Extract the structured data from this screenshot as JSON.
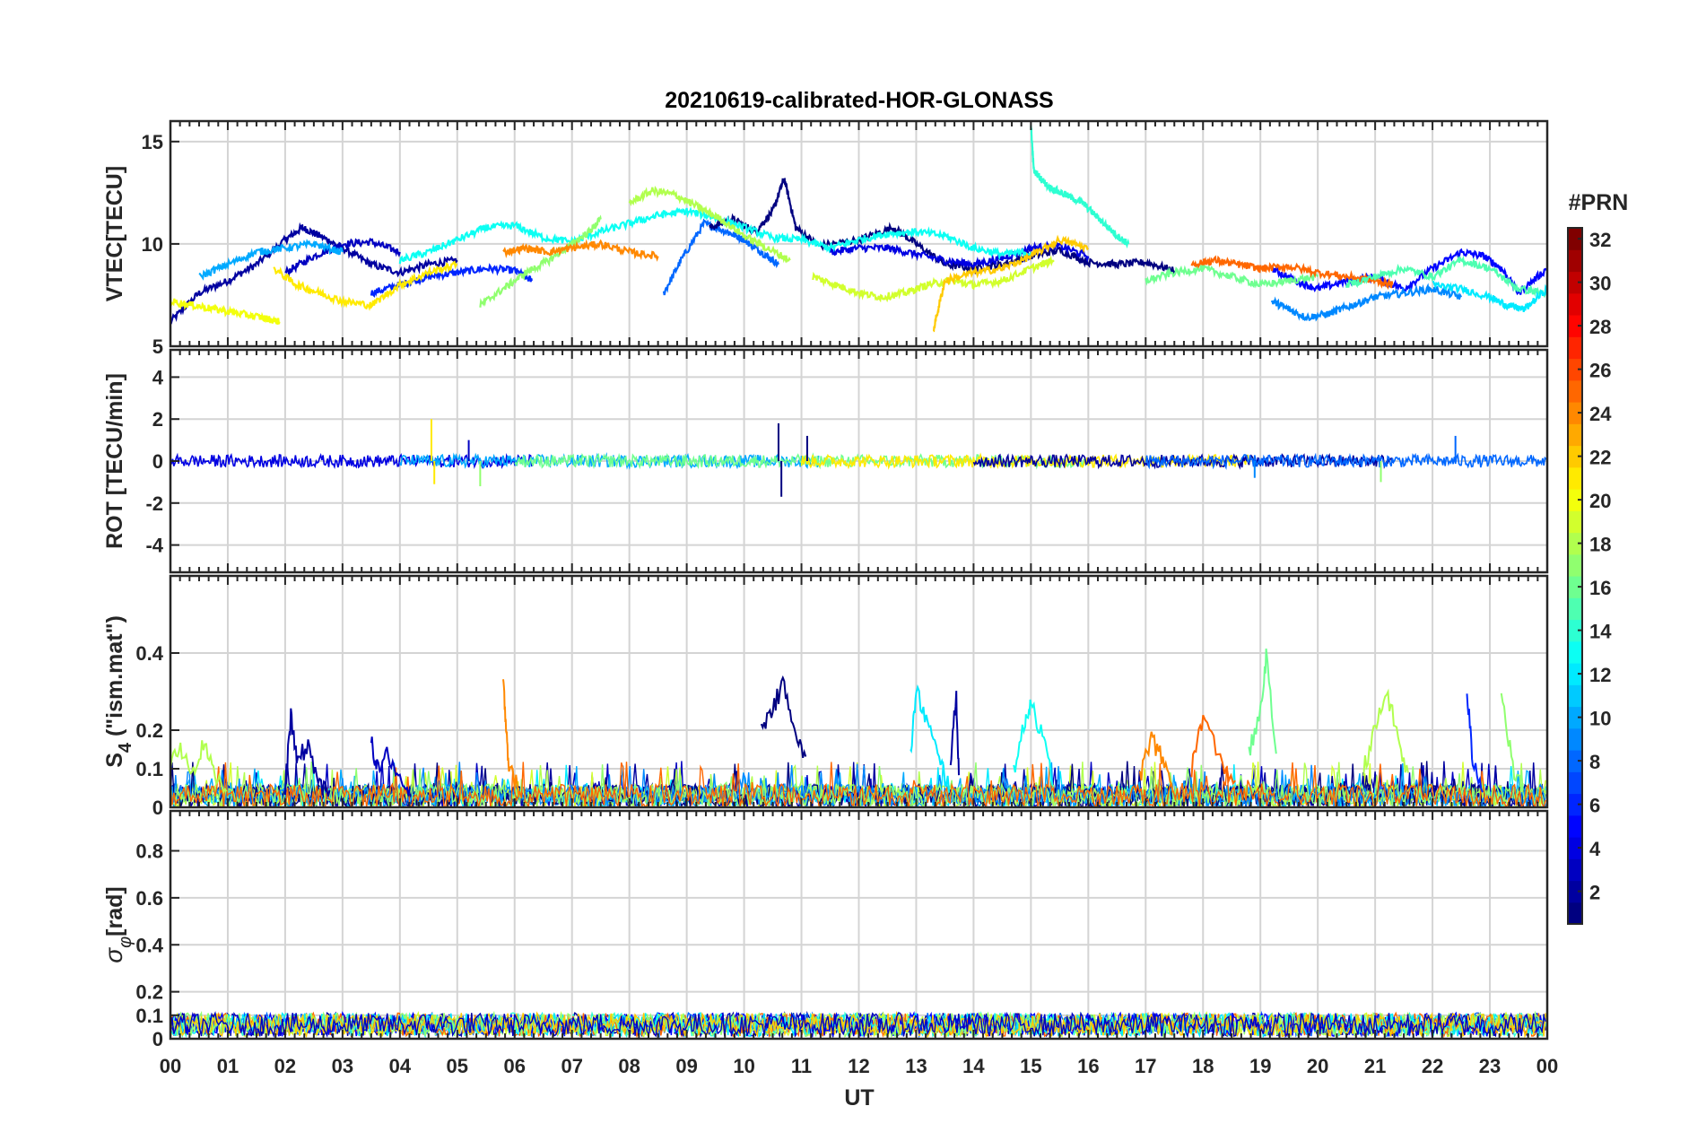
{
  "chart_data": {
    "type": "line",
    "title": "20210619-calibrated-HOR-GLONASS",
    "xlabel": "UT",
    "x_ticks": [
      "00",
      "01",
      "02",
      "03",
      "04",
      "05",
      "06",
      "07",
      "08",
      "09",
      "10",
      "11",
      "12",
      "13",
      "14",
      "15",
      "16",
      "17",
      "18",
      "19",
      "20",
      "21",
      "22",
      "23",
      "00"
    ],
    "xlim": [
      0,
      24
    ],
    "grid": true,
    "colorbar": {
      "label": "#PRN",
      "range": [
        1,
        32
      ],
      "ticks": [
        "2",
        "4",
        "6",
        "8",
        "10",
        "12",
        "14",
        "16",
        "18",
        "20",
        "22",
        "24",
        "26",
        "28",
        "30",
        "32"
      ],
      "colormap": "jet"
    },
    "panels": [
      {
        "id": "vtec",
        "ylabel_main": "VTEC[TECU]",
        "ylim": [
          5,
          16
        ],
        "yticks": [
          5,
          10,
          15
        ],
        "ytick_labels": [
          "5",
          "10",
          "15"
        ],
        "series": [
          {
            "prn": 2,
            "x": [
              0,
              0.5,
              1,
              1.5,
              2,
              2.3,
              2.6,
              3,
              3.5,
              4,
              4.5,
              5
            ],
            "y": [
              6.2,
              7.6,
              8.2,
              9.0,
              10.2,
              10.8,
              10.4,
              9.8,
              9.0,
              8.6,
              9.0,
              9.2
            ]
          },
          {
            "prn": 3,
            "x": [
              2,
              2.5,
              3,
              3.5,
              4
            ],
            "y": [
              8.6,
              9.4,
              10.0,
              10.1,
              9.6
            ]
          },
          {
            "prn": 6,
            "x": [
              3.5,
              4,
              4.5,
              5,
              5.5,
              6,
              6.3
            ],
            "y": [
              7.6,
              8.0,
              8.4,
              8.6,
              8.8,
              8.7,
              8.2
            ]
          },
          {
            "prn": 8,
            "x": [
              8.6,
              8.9,
              9.3,
              9.7,
              10,
              10.3,
              10.6
            ],
            "y": [
              7.6,
              9.2,
              11.0,
              10.6,
              10.2,
              9.6,
              9.0
            ]
          },
          {
            "prn": 1,
            "x": [
              9.4,
              9.8,
              10.2,
              10.5,
              10.7,
              10.9,
              11.3,
              12,
              12.6,
              13,
              13.5,
              14,
              14.5,
              15,
              15.5,
              16,
              16.5,
              17,
              17.5
            ],
            "y": [
              10.8,
              11.2,
              10.6,
              11.6,
              13.2,
              10.8,
              9.9,
              10.2,
              10.8,
              10.0,
              9.0,
              8.8,
              9.0,
              9.4,
              9.7,
              9.1,
              9.0,
              9.1,
              8.7
            ]
          },
          {
            "prn": 4,
            "x": [
              11.5,
              12,
              12.5,
              13,
              13.5,
              14,
              14.5,
              15,
              15.5,
              16
            ],
            "y": [
              9.6,
              9.8,
              9.8,
              9.5,
              9.2,
              9.0,
              9.3,
              9.8,
              9.9,
              9.4
            ]
          },
          {
            "prn": 5,
            "x": [
              19.2,
              19.6,
              20,
              20.5,
              21,
              21.5,
              22,
              22.5,
              22.9,
              23.2,
              23.5,
              24
            ],
            "y": [
              8.8,
              8.2,
              7.8,
              8.2,
              8.4,
              7.8,
              8.8,
              9.6,
              9.4,
              8.8,
              7.6,
              8.8
            ]
          },
          {
            "prn": 9,
            "x": [
              19.2,
              19.5,
              19.8,
              20.2,
              20.6,
              21,
              21.5,
              22,
              22.5
            ],
            "y": [
              7.2,
              6.8,
              6.4,
              6.6,
              7.0,
              7.4,
              7.6,
              7.8,
              7.4
            ]
          },
          {
            "prn": 10,
            "x": [
              0.5,
              1,
              1.5,
              2,
              2.5,
              3
            ],
            "y": [
              8.4,
              9.0,
              9.6,
              9.8,
              10.0,
              9.6
            ]
          },
          {
            "prn": 13,
            "x": [
              4,
              4.5,
              5,
              5.5,
              6,
              6.5,
              7,
              7.5,
              8,
              8.5,
              9,
              9.5,
              10,
              10.5,
              11,
              11.5,
              12,
              12.5,
              13,
              13.5,
              14,
              14.5,
              15
            ],
            "y": [
              9.2,
              9.6,
              10.2,
              10.8,
              10.9,
              10.3,
              10.1,
              10.6,
              11.0,
              11.4,
              11.6,
              11.3,
              10.8,
              10.3,
              10.2,
              9.8,
              10.2,
              10.5,
              10.6,
              10.4,
              9.8,
              9.5,
              9.6
            ]
          },
          {
            "prn": 14,
            "x": [
              15,
              15.05,
              15.3,
              15.6,
              15.9,
              16.2,
              16.5,
              16.7
            ],
            "y": [
              15.8,
              13.6,
              12.8,
              12.4,
              12.0,
              11.2,
              10.4,
              10.0
            ]
          },
          {
            "prn": 17,
            "x": [
              5.4,
              5.8,
              6.2,
              6.6,
              7,
              7.3,
              7.5
            ],
            "y": [
              7.0,
              7.8,
              8.6,
              9.2,
              10.0,
              10.6,
              11.2
            ]
          },
          {
            "prn": 16,
            "x": [
              17,
              17.5,
              18,
              18.5,
              19,
              19.5,
              20
            ],
            "y": [
              8.2,
              8.6,
              8.8,
              8.4,
              8.0,
              8.2,
              8.4
            ]
          },
          {
            "prn": 18,
            "x": [
              8,
              8.4,
              8.8,
              9.2,
              9.6,
              10,
              10.4,
              10.8
            ],
            "y": [
              12.0,
              12.6,
              12.4,
              11.8,
              11.2,
              10.4,
              9.8,
              9.2
            ]
          },
          {
            "prn": 19,
            "x": [
              11.2,
              11.6,
              12,
              12.4,
              12.8,
              13.2,
              13.6,
              14,
              14.5,
              15,
              15.4
            ],
            "y": [
              8.4,
              8.0,
              7.6,
              7.4,
              7.6,
              8.0,
              8.2,
              8.0,
              8.2,
              8.8,
              9.2
            ]
          },
          {
            "prn": 20,
            "x": [
              0,
              0.4,
              0.8,
              1.2,
              1.6,
              1.9
            ],
            "y": [
              7.2,
              7.0,
              6.8,
              6.6,
              6.4,
              6.2
            ]
          },
          {
            "prn": 21,
            "x": [
              1.8,
              2.2,
              2.6,
              3,
              3.5,
              4,
              4.5,
              5
            ],
            "y": [
              8.8,
              8.0,
              7.6,
              7.2,
              7.0,
              8.0,
              8.6,
              9.0
            ]
          },
          {
            "prn": 22,
            "x": [
              13.3,
              13.5,
              14,
              14.5,
              15,
              15.5,
              16
            ],
            "y": [
              5.8,
              8.2,
              8.6,
              8.8,
              9.4,
              10.2,
              9.8
            ]
          },
          {
            "prn": 24,
            "x": [
              5.8,
              6.2,
              6.6,
              7,
              7.5,
              8,
              8.5
            ],
            "y": [
              9.6,
              9.8,
              9.6,
              9.8,
              10.0,
              9.6,
              9.4
            ]
          },
          {
            "prn": 25,
            "x": [
              17.8,
              18.2,
              18.6,
              19,
              19.5,
              20,
              20.5,
              21,
              21.3
            ],
            "y": [
              9.0,
              9.2,
              9.0,
              8.8,
              8.9,
              8.6,
              8.4,
              8.2,
              8.0
            ]
          },
          {
            "prn": 15,
            "x": [
              20.5,
              21,
              21.5,
              22,
              22.5,
              23,
              23.5,
              24
            ],
            "y": [
              8.0,
              8.4,
              8.8,
              8.4,
              9.2,
              8.8,
              7.8,
              7.6
            ]
          },
          {
            "prn": 12,
            "x": [
              22,
              22.5,
              23,
              23.3,
              23.6,
              24
            ],
            "y": [
              8.0,
              7.8,
              7.4,
              7.0,
              6.8,
              7.8
            ]
          }
        ]
      },
      {
        "id": "rot",
        "ylabel_main": "ROT [TECU/min]",
        "ylim": [
          -5.3,
          5.3
        ],
        "yticks": [
          -4,
          -2,
          0,
          2,
          4
        ],
        "ytick_labels": [
          "-4",
          "-2",
          "0",
          "2",
          "4"
        ],
        "baseline": 0,
        "noise_amplitude": 0.3,
        "spikes": [
          {
            "x": 4.55,
            "y": 2.0,
            "prn": 21
          },
          {
            "x": 4.6,
            "y": -1.1,
            "prn": 21
          },
          {
            "x": 10.6,
            "y": 1.8,
            "prn": 1
          },
          {
            "x": 10.65,
            "y": -1.7,
            "prn": 1
          },
          {
            "x": 11.1,
            "y": 1.2,
            "prn": 1
          },
          {
            "x": 5.4,
            "y": -1.2,
            "prn": 17
          },
          {
            "x": 5.2,
            "y": 1.0,
            "prn": 3
          },
          {
            "x": 18.9,
            "y": -0.8,
            "prn": 9
          },
          {
            "x": 21.1,
            "y": -1.0,
            "prn": 17
          },
          {
            "x": 22.4,
            "y": 1.2,
            "prn": 8
          }
        ]
      },
      {
        "id": "s4",
        "ylabel_main": "S",
        "ylabel_sub": "4",
        "ylabel_suffix": " (\"ism.mat\")",
        "ylim": [
          0,
          0.6
        ],
        "yticks": [
          0,
          0.1,
          0.2,
          0.4
        ],
        "ytick_labels": [
          "0",
          "0.1",
          "0.2",
          "0.4"
        ],
        "noise_amplitude": 0.06,
        "bursts": [
          {
            "x": [
              0,
              0.2,
              0.4,
              0.6,
              0.8,
              1.0
            ],
            "y": [
              0.12,
              0.15,
              0.1,
              0.17,
              0.08,
              0.03
            ],
            "prn": 18
          },
          {
            "x": [
              2.0,
              2.1,
              2.2,
              2.4,
              2.6,
              2.8
            ],
            "y": [
              0.04,
              0.24,
              0.12,
              0.16,
              0.06,
              0.02
            ],
            "prn": 2
          },
          {
            "x": [
              3.5,
              3.6,
              3.8,
              4.0,
              4.2
            ],
            "y": [
              0.18,
              0.1,
              0.14,
              0.06,
              0.03
            ],
            "prn": 3
          },
          {
            "x": [
              5.8,
              5.85,
              5.9,
              6.1
            ],
            "y": [
              0.32,
              0.22,
              0.1,
              0.04
            ],
            "prn": 24
          },
          {
            "x": [
              10.3,
              10.5,
              10.7,
              10.9,
              11.1
            ],
            "y": [
              0.2,
              0.26,
              0.32,
              0.2,
              0.1
            ],
            "prn": 1
          },
          {
            "x": [
              12.9,
              13.0,
              13.2,
              13.4,
              13.6
            ],
            "y": [
              0.14,
              0.3,
              0.22,
              0.12,
              0.05
            ],
            "prn": 12
          },
          {
            "x": [
              13.6,
              13.7,
              13.75
            ],
            "y": [
              0.12,
              0.29,
              0.05
            ],
            "prn": 2
          },
          {
            "x": [
              14.7,
              14.9,
              15.0,
              15.2,
              15.4
            ],
            "y": [
              0.1,
              0.22,
              0.28,
              0.18,
              0.06
            ],
            "prn": 13
          },
          {
            "x": [
              16.9,
              17.1,
              17.3,
              17.5
            ],
            "y": [
              0.08,
              0.18,
              0.12,
              0.05
            ],
            "prn": 24
          },
          {
            "x": [
              17.8,
              18.0,
              18.3,
              18.6
            ],
            "y": [
              0.1,
              0.24,
              0.12,
              0.06
            ],
            "prn": 25
          },
          {
            "x": [
              18.8,
              19.0,
              19.1,
              19.3
            ],
            "y": [
              0.14,
              0.24,
              0.39,
              0.1
            ],
            "prn": 16
          },
          {
            "x": [
              20.8,
              21.0,
              21.2,
              21.4,
              21.6
            ],
            "y": [
              0.1,
              0.2,
              0.3,
              0.18,
              0.06
            ],
            "prn": 18
          },
          {
            "x": [
              22.6,
              22.7,
              22.9
            ],
            "y": [
              0.3,
              0.12,
              0.05
            ],
            "prn": 6
          },
          {
            "x": [
              23.2,
              23.4,
              23.6
            ],
            "y": [
              0.3,
              0.1,
              0.04
            ],
            "prn": 17
          }
        ]
      },
      {
        "id": "sigma",
        "ylabel_main": "σ",
        "ylabel_sub": "φ",
        "ylabel_suffix": "[rad]",
        "ylim": [
          0,
          0.97
        ],
        "yticks": [
          0,
          0.1,
          0.2,
          0.4,
          0.6,
          0.8
        ],
        "ytick_labels": [
          "0",
          "0.1",
          "0.2",
          "0.4",
          "0.6",
          "0.8"
        ],
        "noise_amplitude": 0.1,
        "baseline": 0.06
      }
    ]
  },
  "colors": {
    "axis": "#262626",
    "grid": "#d4d4d4",
    "background": "#ffffff"
  }
}
